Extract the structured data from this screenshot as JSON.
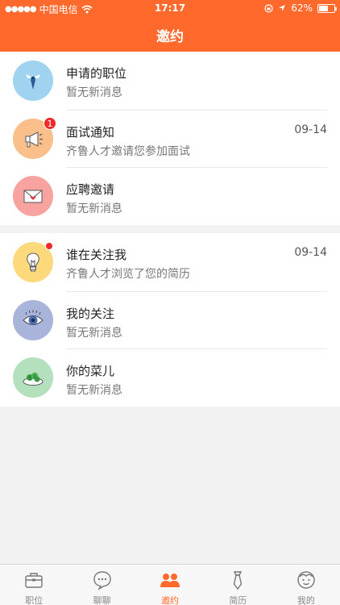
{
  "status_bar": {
    "signal_dots": "●●●●●",
    "carrier": "中国电信",
    "time": "17:17",
    "battery_percent": "62%",
    "battery_level": 0.62
  },
  "nav": {
    "title": "邀约"
  },
  "groups": [
    {
      "items": [
        {
          "title": "申请的职位",
          "subtitle": "暂无新消息",
          "date": "",
          "icon": "tie-icon",
          "color": "#9fd3ef"
        },
        {
          "title": "面试通知",
          "subtitle": "齐鲁人才邀请您参加面试",
          "date": "09-14",
          "icon": "megaphone-icon",
          "color": "#fbbf8c",
          "badge": "1"
        },
        {
          "title": "应聘邀请",
          "subtitle": "暂无新消息",
          "date": "",
          "icon": "envelope-icon",
          "color": "#f9a3a0"
        }
      ]
    },
    {
      "items": [
        {
          "title": "谁在关注我",
          "subtitle": "齐鲁人才浏览了您的简历",
          "date": "09-14",
          "icon": "lightbulb-icon",
          "color": "#fcd97a"
        },
        {
          "title": "我的关注",
          "subtitle": "暂无新消息",
          "date": "",
          "icon": "eye-icon",
          "color": "#a9b4da"
        },
        {
          "title": "你的菜儿",
          "subtitle": "暂无新消息",
          "date": "",
          "icon": "vegetable-plate-icon",
          "color": "#b5e0bd"
        }
      ]
    }
  ],
  "tabbar": {
    "active_color": "#ff6a2c",
    "tabs": [
      {
        "label": "职位",
        "icon": "briefcase-icon"
      },
      {
        "label": "聊聊",
        "icon": "chat-bubble-icon"
      },
      {
        "label": "邀约",
        "icon": "people-icon",
        "active": true
      },
      {
        "label": "简历",
        "icon": "tie-icon"
      },
      {
        "label": "我的",
        "icon": "face-icon"
      }
    ]
  }
}
